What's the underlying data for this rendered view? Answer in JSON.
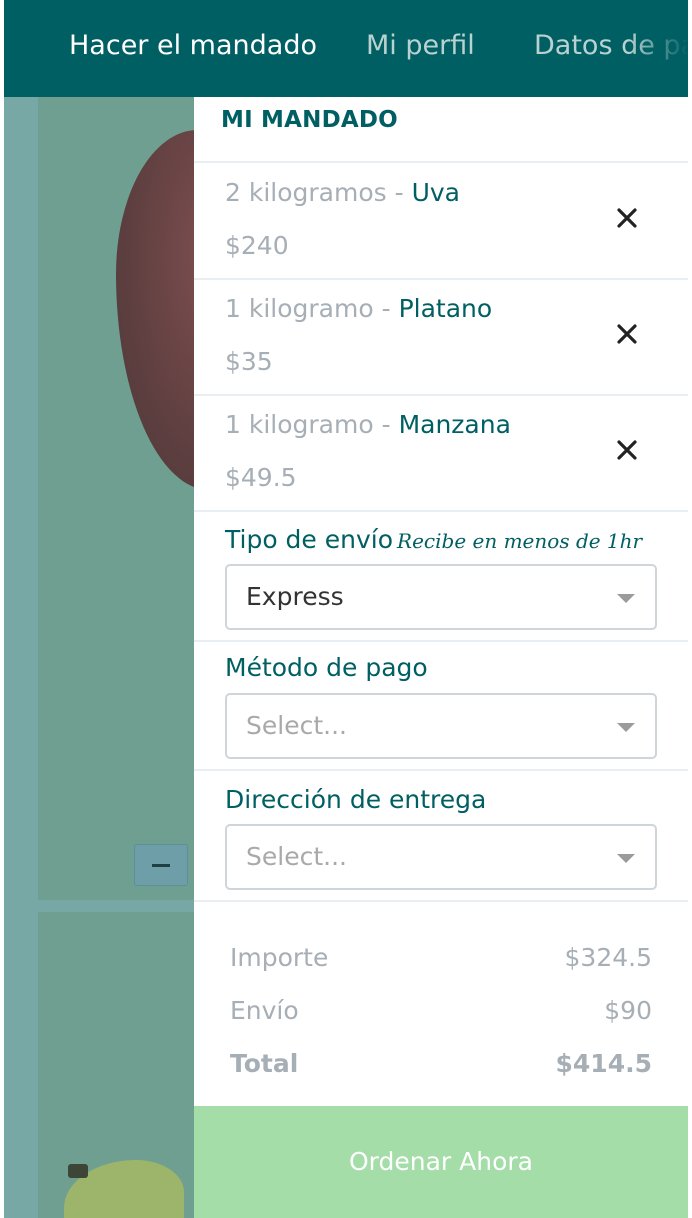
{
  "nav": {
    "items": [
      "Hacer el mandado",
      "Mi perfil",
      "Datos de pago"
    ]
  },
  "cart": {
    "title": "MI MANDADO",
    "items": [
      {
        "qty": "2 kilogramos",
        "sep": " - ",
        "name": "Uva",
        "price": "$240"
      },
      {
        "qty": "1 kilogramo",
        "sep": " - ",
        "name": "Platano",
        "price": "$35"
      },
      {
        "qty": "1 kilogramo",
        "sep": " - ",
        "name": "Manzana",
        "price": "$49.5"
      }
    ],
    "remove_icon": "close-icon"
  },
  "shipping": {
    "label": "Tipo de envío",
    "hint": "Recibe en menos de 1hr",
    "value": "Express"
  },
  "payment": {
    "label": "Método de pago",
    "placeholder": "Select..."
  },
  "address": {
    "label": "Dirección de entrega",
    "placeholder": "Select..."
  },
  "totals": {
    "subtotal_label": "Importe",
    "subtotal": "$324.5",
    "shipping_label": "Envío",
    "shipping": "$90",
    "total_label": "Total",
    "total": "$414.5"
  },
  "order_button": "Ordenar Ahora",
  "colors": {
    "brand": "#005f63",
    "button": "#a4dda8",
    "muted_text": "#a6aeb6"
  }
}
